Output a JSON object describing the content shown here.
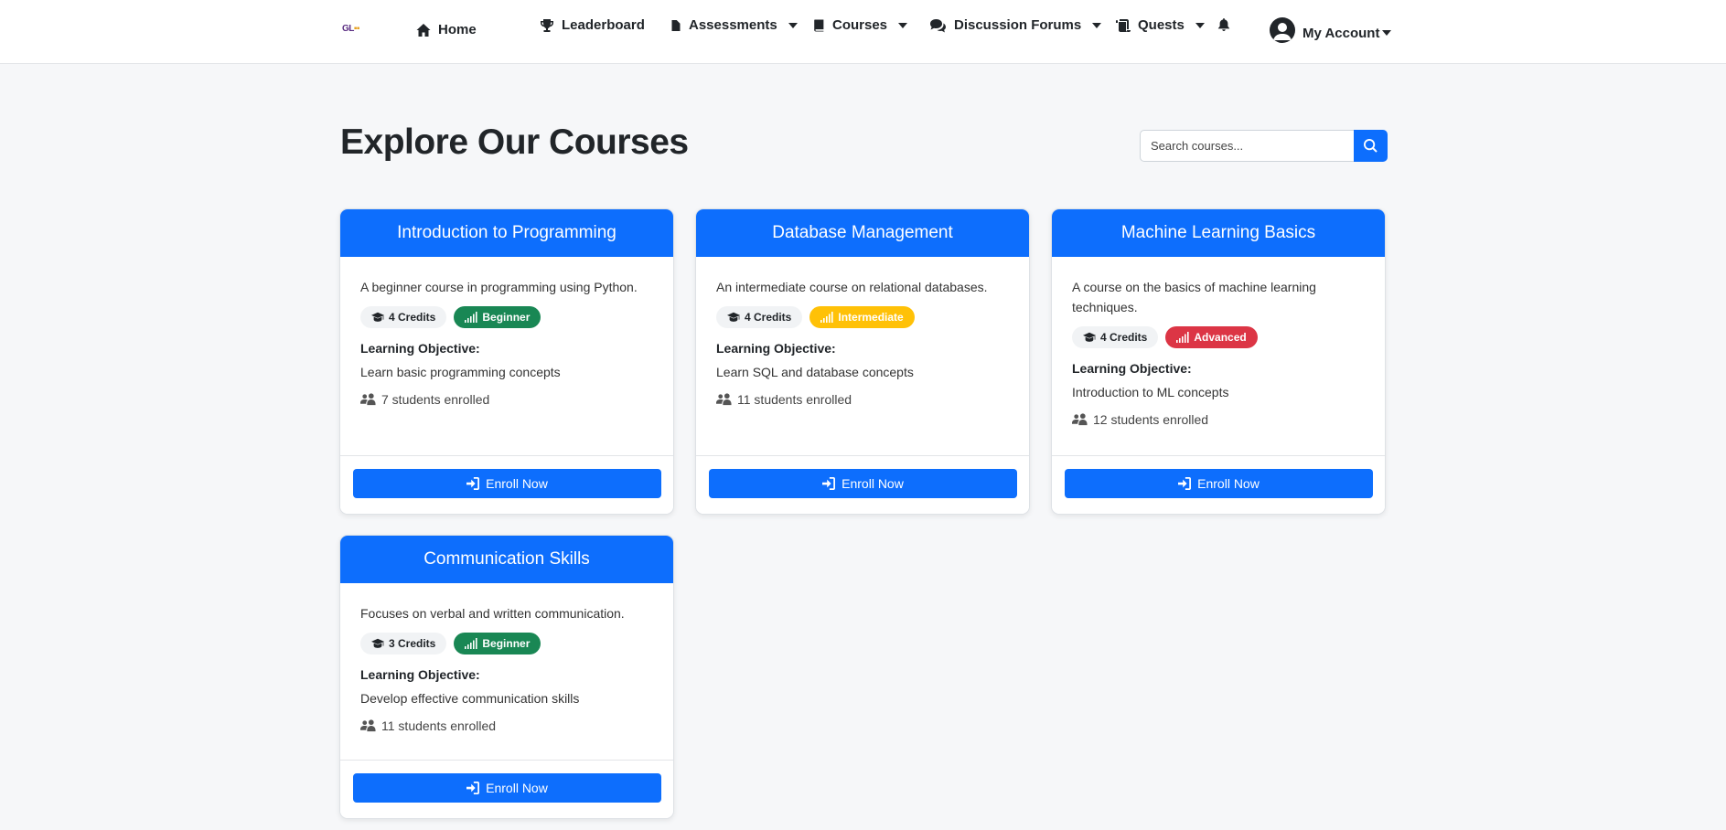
{
  "nav": {
    "logo_text": "GL",
    "home": "Home",
    "leaderboard": "Leaderboard",
    "assessments": "Assessments",
    "courses": "Courses",
    "discussion_forums": "Discussion Forums",
    "quests": "Quests",
    "my_account": "My Account"
  },
  "header": {
    "title": "Explore Our Courses",
    "search_placeholder": "Search courses..."
  },
  "courses": [
    {
      "title": "Introduction to Programming",
      "description": "A beginner course in programming using Python.",
      "credits": "4 Credits",
      "level": "Beginner",
      "objective_label": "Learning Objective:",
      "objective": "Learn basic programming concepts",
      "enrolled": "7 students enrolled",
      "button": "Enroll Now"
    },
    {
      "title": "Database Management",
      "description": "An intermediate course on relational databases.",
      "credits": "4 Credits",
      "level": "Intermediate",
      "objective_label": "Learning Objective:",
      "objective": "Learn SQL and database concepts",
      "enrolled": "11 students enrolled",
      "button": "Enroll Now"
    },
    {
      "title": "Machine Learning Basics",
      "description": "A course on the basics of machine learning techniques.",
      "credits": "4 Credits",
      "level": "Advanced",
      "objective_label": "Learning Objective:",
      "objective": "Introduction to ML concepts",
      "enrolled": "12 students enrolled",
      "button": "Enroll Now"
    },
    {
      "title": "Communication Skills",
      "description": "Focuses on verbal and written communication.",
      "credits": "3 Credits",
      "level": "Beginner",
      "objective_label": "Learning Objective:",
      "objective": "Develop effective communication skills",
      "enrolled": "11 students enrolled",
      "button": "Enroll Now"
    }
  ],
  "colors": {
    "primary": "#0d6efd",
    "beginner": "#198754",
    "intermediate": "#ffc107",
    "advanced": "#dc3545"
  },
  "icons": {
    "home": "home-icon",
    "leaderboard": "trophy-icon",
    "assessments": "file-icon",
    "courses": "book-icon",
    "forums": "comments-icon",
    "quests": "scroll-icon",
    "notifications": "bell-icon",
    "account": "user-circle-icon",
    "search": "search-icon",
    "credits": "graduation-cap-icon",
    "level": "signal-icon",
    "enrolled": "users-icon",
    "enroll": "sign-in-icon"
  }
}
